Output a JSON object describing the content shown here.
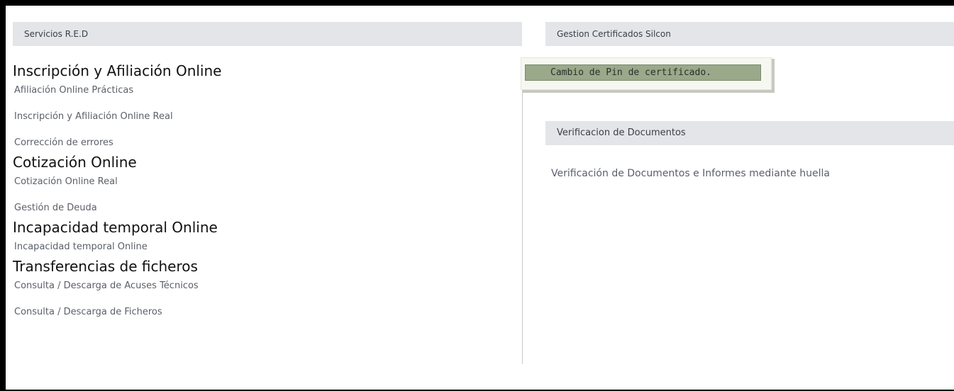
{
  "left_panel": {
    "header": "Servicios R.E.D",
    "groups": [
      {
        "title": "Inscripción y Afiliación Online",
        "links": [
          "Afiliación Online Prácticas",
          "Inscripción y Afiliación Online Real",
          "Corrección de errores"
        ]
      },
      {
        "title": "Cotización Online",
        "links": [
          "Cotización Online Real",
          "Gestión de Deuda"
        ]
      },
      {
        "title": "Incapacidad temporal Online",
        "links": [
          "Incapacidad temporal Online"
        ]
      },
      {
        "title": "Transferencias de ficheros",
        "links": [
          "Consulta / Descarga de Acuses Técnicos",
          "Consulta / Descarga de Ficheros"
        ]
      }
    ]
  },
  "right_panel": {
    "certificados_header": "Gestion Certificados Silcon",
    "pin_button": "Cambio de Pin de certificado.",
    "verificacion_header": "Verificacion de Documentos",
    "verificacion_link": "Verificación de Documentos e Informes mediante huella"
  },
  "colors": {
    "header_bg": "#e3e5e8",
    "pin_button_bg": "#9aa98a",
    "link_text": "#5b6068"
  }
}
